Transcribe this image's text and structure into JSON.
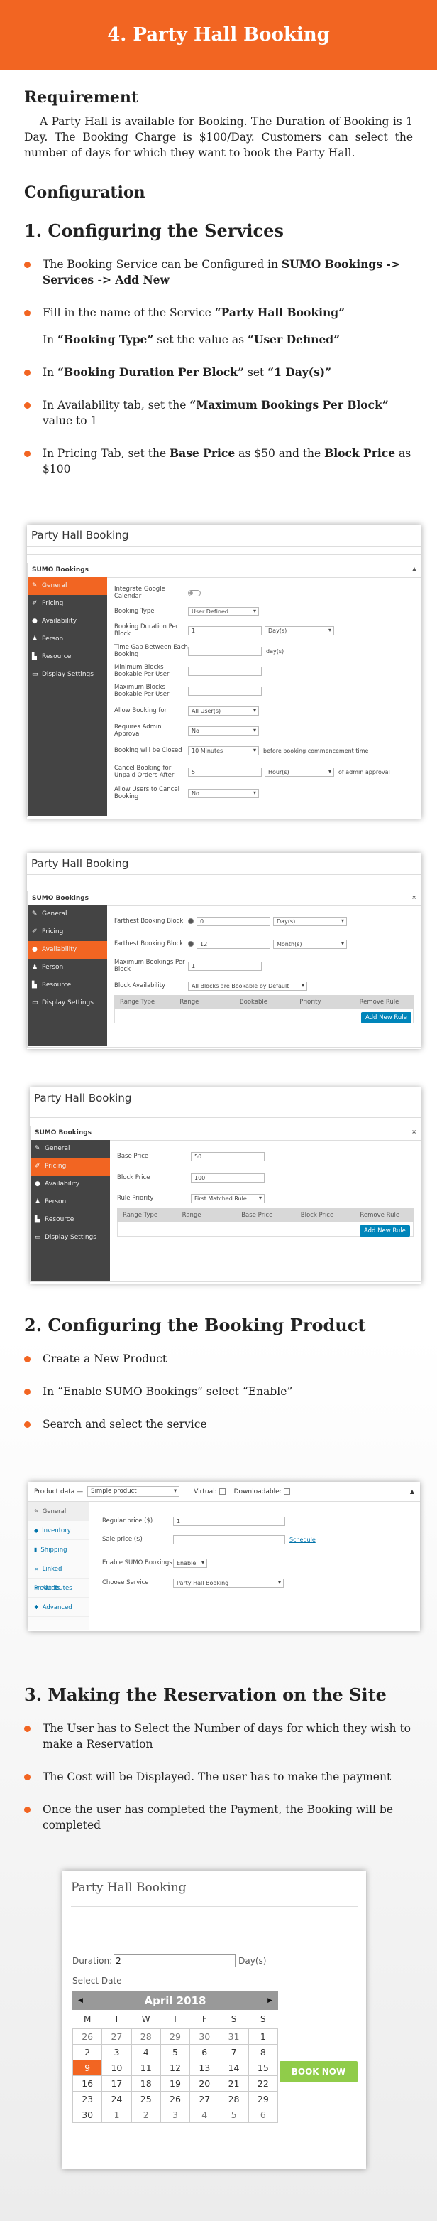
{
  "banner": {
    "title": "4. Party Hall Booking"
  },
  "requirement": {
    "heading": "Requirement",
    "text": "A Party Hall is available for Booking. The Duration of Booking is 1 Day. The Booking Charge is $100/Day. Customers can select the number of days for which they want to book the Party Hall."
  },
  "configuration": {
    "heading": "Configuration"
  },
  "section1": {
    "heading": "1. Configuring the Services",
    "b1_pre": "The Booking Service can be Configured in ",
    "b1_bold": "SUMO Bookings -> Services -> Add New",
    "b2_pre": "Fill in the name of the Service ",
    "b2_bold": "“Party Hall Booking”",
    "b3_pre": "In ",
    "b3_bold1": "“Booking Type”",
    "b3_mid": " set the value as ",
    "b3_bold2": "“User Defined”",
    "b4_pre": "In ",
    "b4_bold1": "“Booking Duration Per Block”",
    "b4_mid": " set ",
    "b4_bold2": "“1 Day(s)”",
    "b5_pre": "In Availability tab, set the ",
    "b5_bold": "“Maximum Bookings Per Block”",
    "b5_post": " value to 1",
    "b6_pre": "In Pricing Tab, set the ",
    "b6_bold1": "Base Price",
    "b6_mid": " as $50 and the ",
    "b6_bold2": "Block Price",
    "b6_post": " as $100"
  },
  "shot1": {
    "title": "Party Hall Booking",
    "panel": "SUMO Bookings",
    "tabs": [
      "General",
      "Pricing",
      "Availability",
      "Person",
      "Resource",
      "Display Settings"
    ],
    "fields": [
      {
        "label": "Integrate Google Calendar"
      },
      {
        "label": "Booking Type",
        "value": "User Defined"
      },
      {
        "label": "Booking Duration Per Block",
        "value": "1",
        "unit": "Day(s)"
      },
      {
        "label": "Time Gap Between Each Booking",
        "value": "",
        "unit": "day(s)"
      },
      {
        "label": "Minimum Blocks Bookable Per User",
        "value": ""
      },
      {
        "label": "Maximum Blocks Bookable Per User",
        "value": ""
      },
      {
        "label": "Allow Booking for",
        "value": "All User(s)"
      },
      {
        "label": "Requires Admin Approval",
        "value": "No"
      },
      {
        "label": "Booking will be Closed",
        "value": "10 Minutes",
        "after": "before booking commencement time"
      },
      {
        "label": "Cancel Booking for Unpaid Orders After",
        "value": "5",
        "unit": "Hour(s)",
        "after": "of admin approval"
      },
      {
        "label": "Allow Users to Cancel Booking",
        "value": "No"
      }
    ]
  },
  "shot2": {
    "title": "Party Hall Booking",
    "panel": "SUMO Bookings",
    "tabs": [
      "General",
      "Pricing",
      "Availability",
      "Person",
      "Resource",
      "Display Settings"
    ],
    "fields": [
      {
        "label": "Farthest Booking Block",
        "value": "0",
        "unit": "Day(s)"
      },
      {
        "label": "Farthest Booking Block",
        "value": "12",
        "unit": "Month(s)"
      },
      {
        "label": "Maximum Bookings Per Block",
        "value": "1"
      },
      {
        "label": "Block Availability",
        "value": "All Blocks are Bookable by Default"
      }
    ],
    "columns": [
      "Range Type",
      "Range",
      "Bookable",
      "Priority",
      "Remove Rule"
    ],
    "add_button": "Add New Rule"
  },
  "shot3": {
    "title": "Party Hall Booking",
    "panel": "SUMO Bookings",
    "tabs": [
      "General",
      "Pricing",
      "Availability",
      "Person",
      "Resource",
      "Display Settings"
    ],
    "fields": [
      {
        "label": "Base Price",
        "value": "50"
      },
      {
        "label": "Block Price",
        "value": "100"
      },
      {
        "label": "Rule Priority",
        "value": "First Matched Rule"
      }
    ],
    "columns": [
      "Range Type",
      "Range",
      "Base Price",
      "Block Price",
      "Remove Rule"
    ],
    "add_button": "Add New Rule"
  },
  "section2": {
    "heading": "2. Configuring the Booking Product",
    "b1": "Create a New Product",
    "b2": "In “Enable SUMO Bookings” select “Enable”",
    "b3": "Search and select the service"
  },
  "shot4": {
    "label": "Product data —",
    "type": "Simple product",
    "virtual": "Virtual:",
    "downloadable": "Downloadable:",
    "tabs": [
      "General",
      "Inventory",
      "Shipping",
      "Linked Products",
      "Attributes",
      "Advanced"
    ],
    "regular_label": "Regular price ($)",
    "regular_value": "1",
    "sale_label": "Sale price ($)",
    "schedule": "Schedule",
    "enable_label": "Enable SUMO Bookings",
    "enable_value": "Enable",
    "service_label": "Choose Service",
    "service_value": "Party Hall Booking"
  },
  "section3": {
    "heading": "3. Making the Reservation on the Site",
    "b1": "The User has to Select the Number of days for which they wish to make a Reservation",
    "b2": "The Cost will be Displayed. The user has to make the payment",
    "b3": "Once the user has completed the Payment, the Booking will be completed"
  },
  "booking": {
    "title": "Party Hall Booking",
    "duration_label": "Duration:",
    "duration_value": "2",
    "duration_unit": "Day(s)",
    "select_date": "Select Date",
    "month": "April 2018",
    "weekdays": [
      "M",
      "T",
      "W",
      "T",
      "F",
      "S",
      "S"
    ],
    "weeks": [
      [
        "26",
        "27",
        "28",
        "29",
        "30",
        "31",
        "1"
      ],
      [
        "2",
        "3",
        "4",
        "5",
        "6",
        "7",
        "8"
      ],
      [
        "9",
        "10",
        "11",
        "12",
        "13",
        "14",
        "15"
      ],
      [
        "16",
        "17",
        "18",
        "19",
        "20",
        "21",
        "22"
      ],
      [
        "23",
        "24",
        "25",
        "26",
        "27",
        "28",
        "29"
      ],
      [
        "30",
        "1",
        "2",
        "3",
        "4",
        "5",
        "6"
      ]
    ],
    "selected": "9",
    "button": "BOOK NOW"
  }
}
